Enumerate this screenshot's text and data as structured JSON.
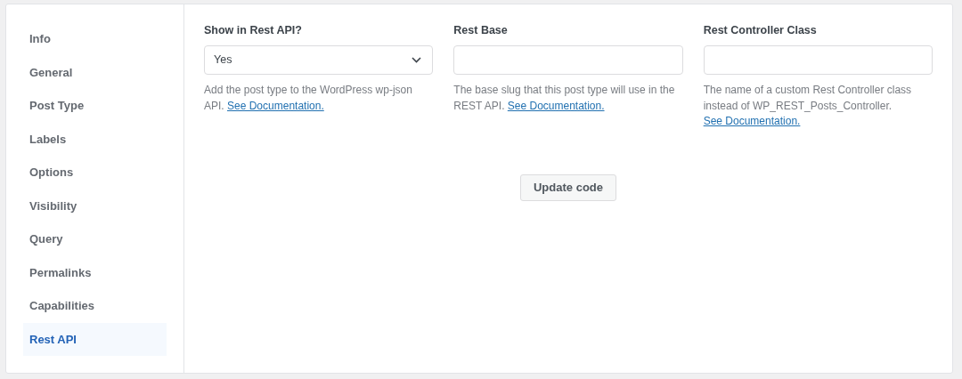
{
  "sidebar": {
    "items": [
      {
        "label": "Info",
        "selected": false
      },
      {
        "label": "General",
        "selected": false
      },
      {
        "label": "Post Type",
        "selected": false
      },
      {
        "label": "Labels",
        "selected": false
      },
      {
        "label": "Options",
        "selected": false
      },
      {
        "label": "Visibility",
        "selected": false
      },
      {
        "label": "Query",
        "selected": false
      },
      {
        "label": "Permalinks",
        "selected": false
      },
      {
        "label": "Capabilities",
        "selected": false
      },
      {
        "label": "Rest API",
        "selected": true
      }
    ]
  },
  "fields": [
    {
      "kind": "select",
      "label": "Show in Rest API?",
      "value": "Yes",
      "help": "Add the post type to the WordPress wp-json API.",
      "link": "See Documentation."
    },
    {
      "kind": "text",
      "label": "Rest Base",
      "help": "The base slug that this post type will use in the REST API.",
      "link": "See Documentation."
    },
    {
      "kind": "text",
      "label": "Rest Controller Class",
      "help": "The name of a custom Rest Controller class instead of WP_REST_Posts_Controller.",
      "link": "See Documentation."
    }
  ],
  "button": "Update code"
}
